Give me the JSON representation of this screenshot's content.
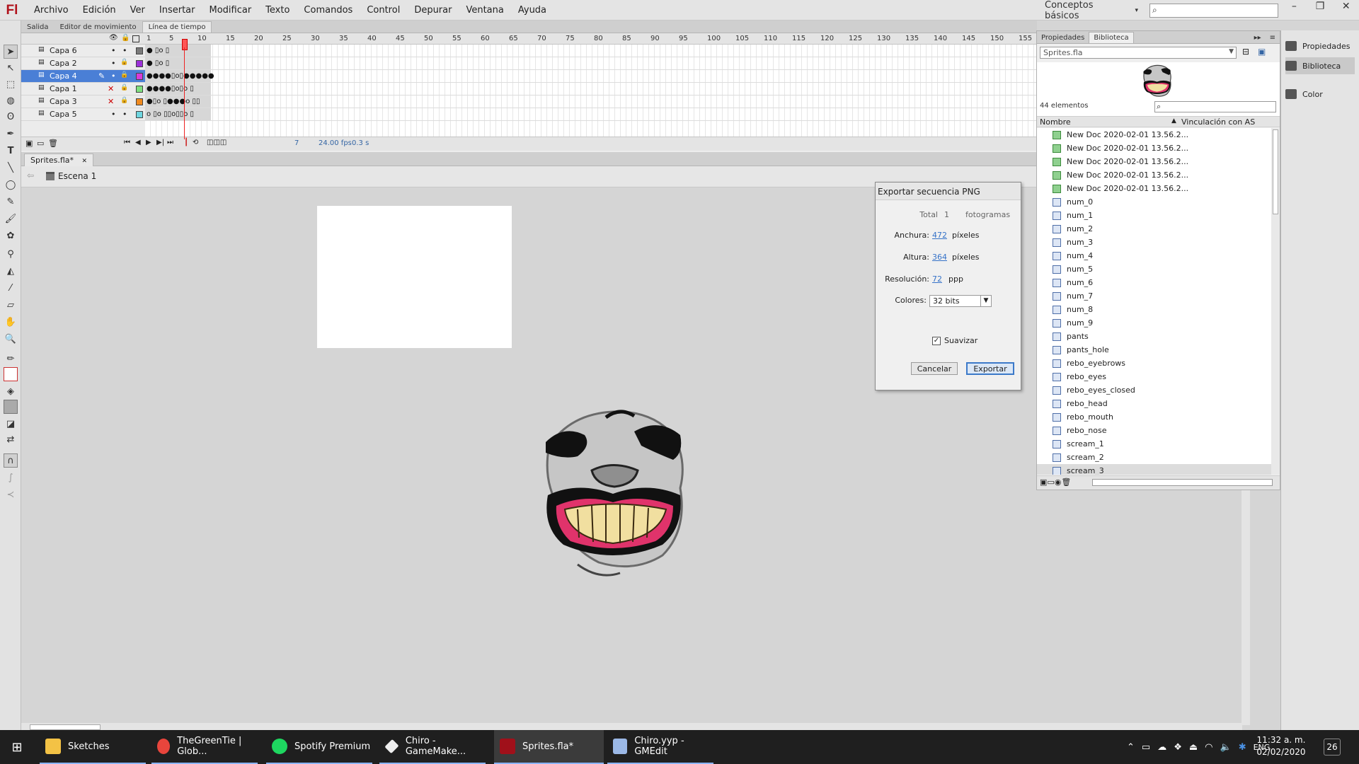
{
  "app": {
    "logo": "Fl",
    "workspace": "Conceptos básicos"
  },
  "menu": [
    "Archivo",
    "Edición",
    "Ver",
    "Insertar",
    "Modificar",
    "Texto",
    "Comandos",
    "Control",
    "Depurar",
    "Ventana",
    "Ayuda"
  ],
  "timeline_tabs": [
    "Salida",
    "Editor de movimiento",
    "Línea de tiempo"
  ],
  "layers": [
    {
      "name": "Capa 6",
      "keys": "●     ▯o     ▯"
    },
    {
      "name": "Capa 2",
      "keys": "●     ▯o     ▯"
    },
    {
      "name": "Capa 4",
      "keys": "●●●●▯o▯●●●●●"
    },
    {
      "name": "Capa 1",
      "keys": "●●●●▯o▯o     ▯"
    },
    {
      "name": "Capa 3",
      "keys": "●▯o  ▯●●●o ▯▯"
    },
    {
      "name": "Capa 5",
      "keys": "o ▯o ▯▯o▯▯o ▯"
    }
  ],
  "layer_colors": [
    "#7a7a7a",
    "#9b30d9",
    "#d93ad9",
    "#7fe07f",
    "#f08a1e",
    "#6fd6e0"
  ],
  "ruler": [
    "1",
    "5",
    "10",
    "15",
    "20",
    "25",
    "30",
    "35",
    "40",
    "45",
    "50",
    "55",
    "60",
    "65",
    "70",
    "75",
    "80",
    "85",
    "90",
    "95",
    "100",
    "105",
    "110",
    "115",
    "120",
    "125",
    "130",
    "135",
    "140",
    "145",
    "150",
    "155"
  ],
  "timeline_footer": {
    "frame": "7",
    "fps": "24.00 fps",
    "time": "0.3 s"
  },
  "document": {
    "tab": "Sprites.fla*",
    "scene": "Escena 1"
  },
  "dialog": {
    "title": "Exportar secuencia PNG",
    "total_label": "Total",
    "total_value": "1",
    "total_unit": "fotogramas",
    "width_label": "Anchura:",
    "width_value": "472",
    "width_unit": "píxeles",
    "height_label": "Altura:",
    "height_value": "364",
    "height_unit": "píxeles",
    "res_label": "Resolución:",
    "res_value": "72",
    "res_unit": "ppp",
    "colors_label": "Colores:",
    "colors_value": "32 bits",
    "smooth_label": "Suavizar",
    "cancel": "Cancelar",
    "export": "Exportar"
  },
  "library": {
    "tabs": [
      "Propiedades",
      "Biblioteca"
    ],
    "file": "Sprites.fla",
    "count": "44 elementos",
    "col_name": "Nombre",
    "col_linkage": "Vinculación con AS",
    "items": [
      {
        "name": "New Doc 2020-02-01 13.56.2...",
        "type": "bitmap"
      },
      {
        "name": "New Doc 2020-02-01 13.56.2...",
        "type": "bitmap"
      },
      {
        "name": "New Doc 2020-02-01 13.56.2...",
        "type": "bitmap"
      },
      {
        "name": "New Doc 2020-02-01 13.56.2...",
        "type": "bitmap"
      },
      {
        "name": "New Doc 2020-02-01 13.56.2...",
        "type": "bitmap"
      },
      {
        "name": "num_0",
        "type": "symbol"
      },
      {
        "name": "num_1",
        "type": "symbol"
      },
      {
        "name": "num_2",
        "type": "symbol"
      },
      {
        "name": "num_3",
        "type": "symbol"
      },
      {
        "name": "num_4",
        "type": "symbol"
      },
      {
        "name": "num_5",
        "type": "symbol"
      },
      {
        "name": "num_6",
        "type": "symbol"
      },
      {
        "name": "num_7",
        "type": "symbol"
      },
      {
        "name": "num_8",
        "type": "symbol"
      },
      {
        "name": "num_9",
        "type": "symbol"
      },
      {
        "name": "pants",
        "type": "symbol"
      },
      {
        "name": "pants_hole",
        "type": "symbol"
      },
      {
        "name": "rebo_eyebrows",
        "type": "symbol"
      },
      {
        "name": "rebo_eyes",
        "type": "symbol"
      },
      {
        "name": "rebo_eyes_closed",
        "type": "symbol"
      },
      {
        "name": "rebo_head",
        "type": "symbol"
      },
      {
        "name": "rebo_mouth",
        "type": "symbol"
      },
      {
        "name": "rebo_nose",
        "type": "symbol"
      },
      {
        "name": "scream_1",
        "type": "symbol"
      },
      {
        "name": "scream_2",
        "type": "symbol"
      },
      {
        "name": "scream_3",
        "type": "symbol"
      }
    ]
  },
  "dock": [
    "Propiedades",
    "Biblioteca",
    "Color"
  ],
  "taskbar": {
    "items": [
      "Sketches",
      "TheGreenTie | Glob...",
      "Spotify Premium",
      "Chiro - GameMake...",
      "Sprites.fla*",
      "Chiro.yyp - GMEdit"
    ],
    "lang": "ENG",
    "time": "11:32 a. m.",
    "date": "02/02/2020",
    "notifications": "26"
  }
}
